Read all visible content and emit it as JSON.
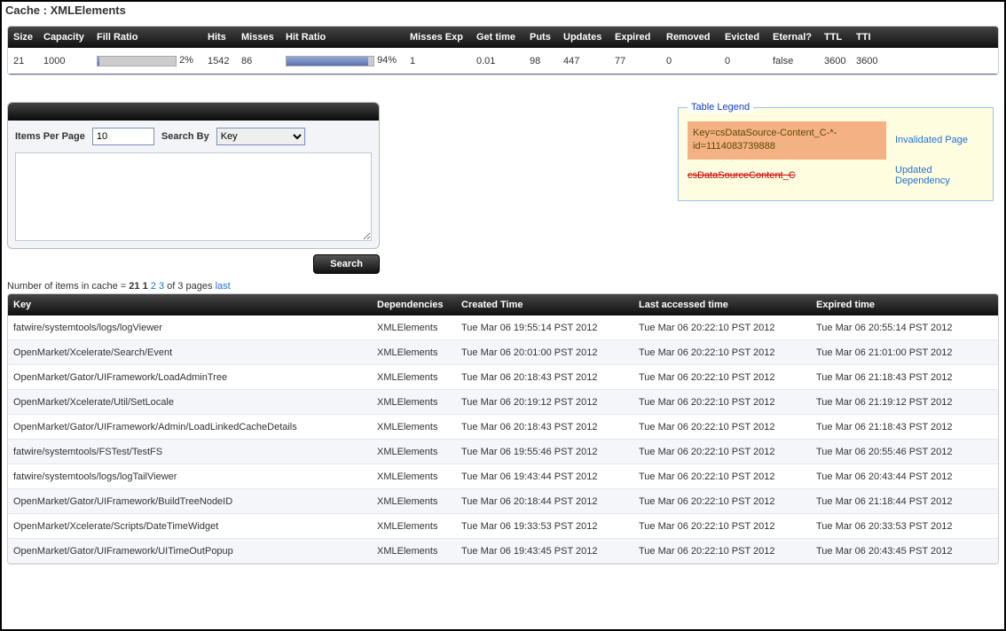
{
  "title": "Cache : XMLElements",
  "stats_headers": [
    "Size",
    "Capacity",
    "Fill Ratio",
    "Hits",
    "Misses",
    "Hit Ratio",
    "Misses Exp",
    "Get time",
    "Puts",
    "Updates",
    "Expired",
    "Removed",
    "Evicted",
    "Eternal?",
    "TTL",
    "TTI"
  ],
  "stats": {
    "size": "21",
    "capacity": "1000",
    "fill_ratio_pct": "2%",
    "hits": "1542",
    "misses": "86",
    "hit_ratio_pct": "94%",
    "misses_exp": "1",
    "get_time": "0.01",
    "puts": "98",
    "updates": "447",
    "expired": "77",
    "removed": "0",
    "evicted": "0",
    "eternal": "false",
    "ttl": "3600",
    "tti": "3600"
  },
  "search": {
    "items_label": "Items Per Page",
    "items_value": "10",
    "searchby_label": "Search By",
    "searchby_value": "Key",
    "button": "Search"
  },
  "legend": {
    "title": "Table Legend",
    "sample_invalidated": "Key=csDataSource-Content_C-*-id=1114083739888",
    "label_invalidated": "Invalidated Page",
    "sample_updated": "csDataSourceContent_C",
    "label_updated": "Updated Dependency"
  },
  "count": {
    "prefix": "Number of items in cache = ",
    "total": "21",
    "page_cur": "1",
    "page2": "2",
    "page3": "3",
    "of": " of 3 pages ",
    "last": "last"
  },
  "table_headers": {
    "key": "Key",
    "dep": "Dependencies",
    "created": "Created Time",
    "accessed": "Last accessed time",
    "expired": "Expired time"
  },
  "rows": [
    {
      "key": "fatwire/systemtools/logs/logViewer",
      "dep": "XMLElements",
      "created": "Tue Mar 06 19:55:14 PST 2012",
      "accessed": "Tue Mar 06 20:22:10 PST 2012",
      "expired": "Tue Mar 06 20:55:14 PST 2012"
    },
    {
      "key": "OpenMarket/Xcelerate/Search/Event",
      "dep": "XMLElements",
      "created": "Tue Mar 06 20:01:00 PST 2012",
      "accessed": "Tue Mar 06 20:22:10 PST 2012",
      "expired": "Tue Mar 06 21:01:00 PST 2012"
    },
    {
      "key": "OpenMarket/Gator/UIFramework/LoadAdminTree",
      "dep": "XMLElements",
      "created": "Tue Mar 06 20:18:43 PST 2012",
      "accessed": "Tue Mar 06 20:22:10 PST 2012",
      "expired": "Tue Mar 06 21:18:43 PST 2012"
    },
    {
      "key": "OpenMarket/Xcelerate/Util/SetLocale",
      "dep": "XMLElements",
      "created": "Tue Mar 06 20:19:12 PST 2012",
      "accessed": "Tue Mar 06 20:22:10 PST 2012",
      "expired": "Tue Mar 06 21:19:12 PST 2012"
    },
    {
      "key": "OpenMarket/Gator/UIFramework/Admin/LoadLinkedCacheDetails",
      "dep": "XMLElements",
      "created": "Tue Mar 06 20:18:43 PST 2012",
      "accessed": "Tue Mar 06 20:22:10 PST 2012",
      "expired": "Tue Mar 06 21:18:43 PST 2012"
    },
    {
      "key": "fatwire/systemtools/FSTest/TestFS",
      "dep": "XMLElements",
      "created": "Tue Mar 06 19:55:46 PST 2012",
      "accessed": "Tue Mar 06 20:22:10 PST 2012",
      "expired": "Tue Mar 06 20:55:46 PST 2012"
    },
    {
      "key": "fatwire/systemtools/logs/logTailViewer",
      "dep": "XMLElements",
      "created": "Tue Mar 06 19:43:44 PST 2012",
      "accessed": "Tue Mar 06 20:22:10 PST 2012",
      "expired": "Tue Mar 06 20:43:44 PST 2012"
    },
    {
      "key": "OpenMarket/Gator/UIFramework/BuildTreeNodeID",
      "dep": "XMLElements",
      "created": "Tue Mar 06 20:18:44 PST 2012",
      "accessed": "Tue Mar 06 20:22:10 PST 2012",
      "expired": "Tue Mar 06 21:18:44 PST 2012"
    },
    {
      "key": "OpenMarket/Xcelerate/Scripts/DateTimeWidget",
      "dep": "XMLElements",
      "created": "Tue Mar 06 19:33:53 PST 2012",
      "accessed": "Tue Mar 06 20:22:10 PST 2012",
      "expired": "Tue Mar 06 20:33:53 PST 2012"
    },
    {
      "key": "OpenMarket/Gator/UIFramework/UITimeOutPopup",
      "dep": "XMLElements",
      "created": "Tue Mar 06 19:43:45 PST 2012",
      "accessed": "Tue Mar 06 20:22:10 PST 2012",
      "expired": "Tue Mar 06 20:43:45 PST 2012"
    }
  ]
}
